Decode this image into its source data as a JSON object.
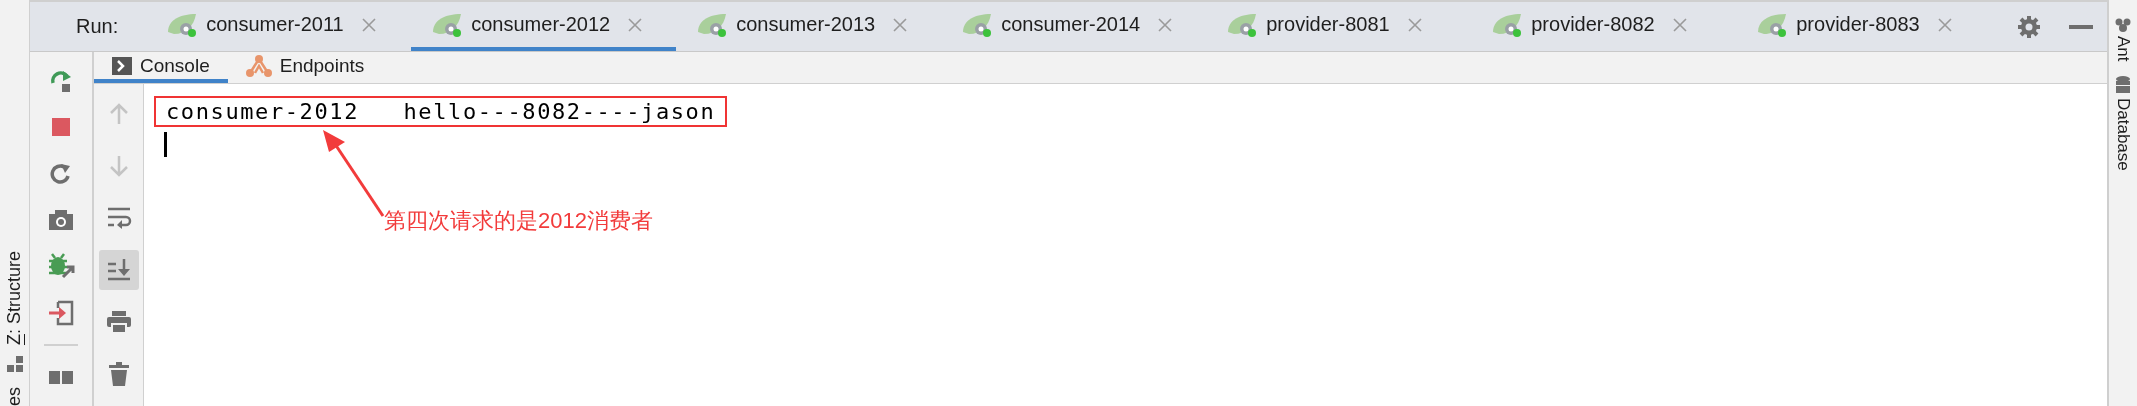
{
  "run_label": "Run:",
  "run_tabs": [
    {
      "label": "consumer-2011",
      "selected": false
    },
    {
      "label": "consumer-2012",
      "selected": true
    },
    {
      "label": "consumer-2013",
      "selected": false
    },
    {
      "label": "consumer-2014",
      "selected": false
    },
    {
      "label": "provider-8081",
      "selected": false
    },
    {
      "label": "provider-8082",
      "selected": false
    },
    {
      "label": "provider-8083",
      "selected": false
    }
  ],
  "left_strip": {
    "mnemonic": "Z",
    "rest": ": Structure",
    "cut_label": "es"
  },
  "right_strip": [
    {
      "label": "Ant",
      "kind": "ant"
    },
    {
      "label": "Database",
      "kind": "database"
    }
  ],
  "run_actions": [
    {
      "kind": "rerun"
    },
    {
      "kind": "stop"
    },
    {
      "kind": "restore"
    },
    {
      "kind": "camera"
    },
    {
      "kind": "debug"
    },
    {
      "kind": "import"
    },
    {
      "kind": "divider"
    },
    {
      "kind": "layout"
    }
  ],
  "console_actions": [
    {
      "kind": "up",
      "disabled": true,
      "on": false
    },
    {
      "kind": "down",
      "disabled": true,
      "on": false
    },
    {
      "kind": "wrap",
      "disabled": false,
      "on": false
    },
    {
      "kind": "scroll-end",
      "disabled": false,
      "on": true
    },
    {
      "kind": "print",
      "disabled": false,
      "on": false
    },
    {
      "kind": "trash",
      "disabled": false,
      "on": false
    }
  ],
  "sub_tabs": [
    {
      "label": "Console",
      "kind": "console",
      "selected": true
    },
    {
      "label": "Endpoints",
      "kind": "endpoints",
      "selected": false
    }
  ],
  "console": {
    "lines": [
      {
        "text": "consumer-2012   hello---8082----jason",
        "highlighted": true
      }
    ],
    "annotation": "第四次请求的是2012消费者"
  }
}
